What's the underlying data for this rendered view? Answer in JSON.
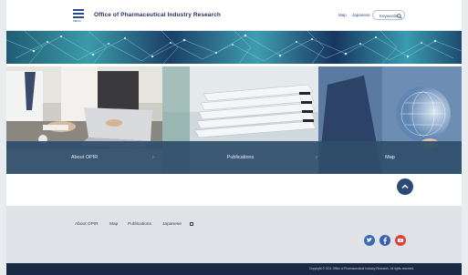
{
  "header": {
    "menu_label": "MENU",
    "site_title": "Office of Pharmaceutical Industry Research",
    "map_label": "Map",
    "language_label": "Japanese",
    "search_value": "Keywords"
  },
  "cards": [
    {
      "label": "About OPIR",
      "chevron": "›"
    },
    {
      "label": "Publications",
      "chevron": "›"
    },
    {
      "label": "Map",
      "chevron": ""
    }
  ],
  "footer": {
    "links": [
      "About OPIR",
      "Map",
      "Publications",
      "Japanese"
    ],
    "social": [
      {
        "name": "twitter-icon",
        "color": "#3b6ab3"
      },
      {
        "name": "facebook-icon",
        "color": "#3b5fb0"
      },
      {
        "name": "youtube-icon",
        "color": "#e0423a"
      }
    ],
    "copyright": "Copyright © 2021 Office of Pharmaceutical Industry Research. All rights reserved."
  },
  "colors": {
    "navy": "#2a4a8a",
    "card_overlay": "#2f4e6c",
    "footer_bg": "#dfe3e8",
    "bottom_bar": "#1b2a44"
  }
}
